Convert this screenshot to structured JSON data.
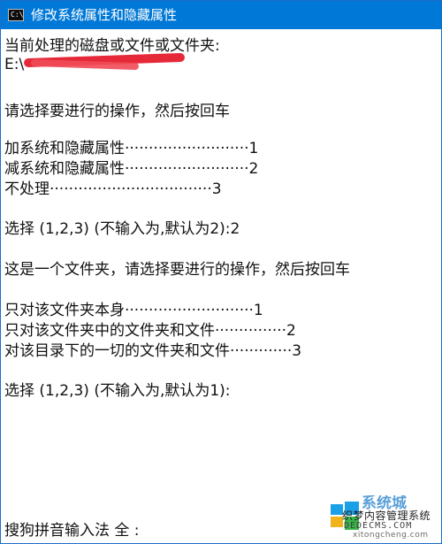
{
  "window": {
    "title": "修改系统属性和隐藏属性",
    "icon_label": "C:\\",
    "accent_color": "#0078d7"
  },
  "console": {
    "lines": [
      "当前处理的磁盘或文件或文件夹:",
      "E:\\",
      "请选择要进行的操作，然后按回车",
      "加系统和隐藏属性··························1",
      "减系统和隐藏属性··························2",
      "不处理··································3",
      "选择 (1,2,3) (不输入为,默认为2):2",
      "这是一个文件夹，请选择要进行的操作，然后按回车",
      "只对该文件夹本身···························1",
      "只对该文件夹中的文件夹和文件···············2",
      "对该目录下的一切的文件夹和文件·············3",
      "选择 (1,2,3) (不输入为,默认为1):",
      "搜狗拼音输入法 全 :"
    ]
  },
  "watermark": {
    "brand": "系统城",
    "subtitle": "织梦内容管理系统",
    "url": "DEDECMS.COM",
    "url2": "xitongcheng.com"
  }
}
